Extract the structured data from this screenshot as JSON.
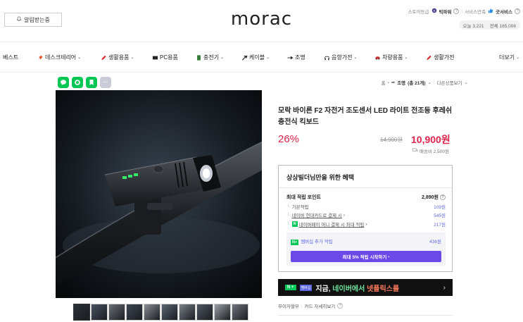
{
  "header": {
    "alarm_button": "알림받는중",
    "logo": "morac",
    "store_grade_label": "스토어등급",
    "store_grade_value": "빅파워",
    "service_label": "서비스만족",
    "service_value": "굿서비스",
    "visit_today": "오늘 3,221",
    "visit_total": "전체 165,006"
  },
  "nav": {
    "items": [
      {
        "label": "베스트",
        "icon": "none",
        "dropdown": false
      },
      {
        "label": "데스크테리어",
        "icon": "pin-icon",
        "dropdown": true
      },
      {
        "label": "생활용품",
        "icon": "pencil-icon",
        "dropdown": true
      },
      {
        "label": "PC용품",
        "icon": "keyboard-icon",
        "dropdown": false
      },
      {
        "label": "충전기",
        "icon": "battery-icon",
        "dropdown": true
      },
      {
        "label": "케이블",
        "icon": "cable-icon",
        "dropdown": true
      },
      {
        "label": "조명",
        "icon": "light-icon",
        "dropdown": false
      },
      {
        "label": "음향가전",
        "icon": "headphone-icon",
        "dropdown": true
      },
      {
        "label": "차량용품",
        "icon": "car-icon",
        "dropdown": true
      },
      {
        "label": "생활가전",
        "icon": "pencil-icon",
        "dropdown": false
      },
      {
        "label": "더보기",
        "icon": "none",
        "dropdown": true
      }
    ]
  },
  "share": {
    "icons": [
      "line-share-icon",
      "kakao-share-icon",
      "bookmark-share-icon",
      "more-share-icon"
    ],
    "more_label": "···"
  },
  "breadcrumb": {
    "home": "홈",
    "category": "조명",
    "count": "(총 21개)",
    "other": "다른상품보기"
  },
  "product": {
    "title": "모락 바이른 F2 자전거 조도센서 LED 라이트 전조등 후레쉬 충전식 킥보드",
    "discount_rate": "26%",
    "original_price": "14,900원",
    "sale_price": "10,900원",
    "delivery": "배송비 2,500원",
    "thumbnail_count": 10
  },
  "benefit": {
    "title": "상상빌더님만을 위한 혜택",
    "total_label": "최대 적립 포인트",
    "total_value": "2,890원",
    "rows": [
      {
        "label": "기본적립",
        "value": "109원",
        "link": false,
        "badge": false
      },
      {
        "label": "네이버 현대카드로 결제 시",
        "value": "545원",
        "link": true,
        "badge": false
      },
      {
        "label": "네이버페이 머니 결제 시 최대 적립",
        "value": "217원",
        "link": true,
        "badge": true
      }
    ],
    "member_badge": "N+",
    "member_label": "멤버십 추가 적립",
    "member_value": "436원",
    "member_button": "최대 5% 적립 시작하기"
  },
  "promo": {
    "badge1": "N +",
    "badge2": "멤버십",
    "text_white": "지금,",
    "text_green": "네이버에서",
    "text_orange": "넷플릭스를",
    "arrow": "›"
  },
  "interest": {
    "label": "무이자할부",
    "link": "카드 자세히보기"
  },
  "colors": {
    "accent_red": "#e0234a",
    "naver_green": "#03c75a",
    "purple": "#6b48e8"
  }
}
